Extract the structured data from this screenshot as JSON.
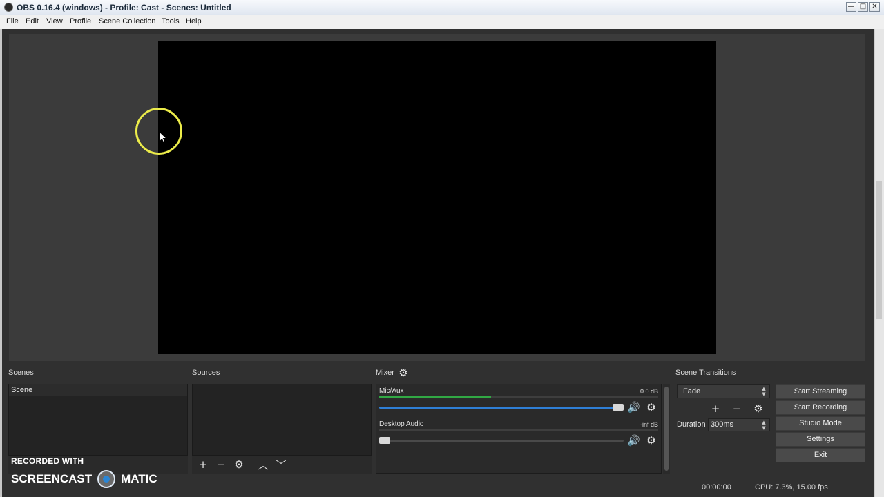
{
  "window": {
    "title": "OBS 0.16.4 (windows) - Profile: Cast - Scenes: Untitled",
    "controls": {
      "minimize": "—",
      "maximize": "□",
      "close": "✕"
    }
  },
  "menu": [
    "File",
    "Edit",
    "View",
    "Profile",
    "Scene Collection",
    "Tools",
    "Help"
  ],
  "docks": {
    "scenes": {
      "title": "Scenes",
      "items": [
        "Scene"
      ]
    },
    "sources": {
      "title": "Sources",
      "items": []
    },
    "mixer": {
      "title": "Mixer",
      "channels": [
        {
          "name": "Mic/Aux",
          "db": "0.0 dB",
          "meter_level": 0.4,
          "volume": 1.0
        },
        {
          "name": "Desktop Audio",
          "db": "-inf dB",
          "meter_level": 0.0,
          "volume": 0.0
        }
      ]
    },
    "transitions": {
      "title": "Scene Transitions",
      "selected": "Fade",
      "duration_label": "Duration",
      "duration_value": "300ms"
    }
  },
  "controls": {
    "start_streaming": "Start Streaming",
    "start_recording": "Start Recording",
    "studio_mode": "Studio Mode",
    "settings": "Settings",
    "exit": "Exit"
  },
  "status": {
    "time": "00:00:00",
    "cpu": "CPU: 7.3%, 15.00 fps"
  },
  "watermark": {
    "line1": "RECORDED WITH",
    "brand_left": "SCREENCAST",
    "brand_right": "MATIC"
  },
  "icons": {
    "add": "+",
    "remove": "−",
    "gear": "⚙",
    "up": "︿",
    "down": "﹀",
    "speaker": "🔊"
  },
  "colors": {
    "panel_bg": "#303030",
    "meter_green": "#31a844",
    "slider_blue": "#2f7fd6",
    "cursor_ring": "#ecec4a"
  }
}
